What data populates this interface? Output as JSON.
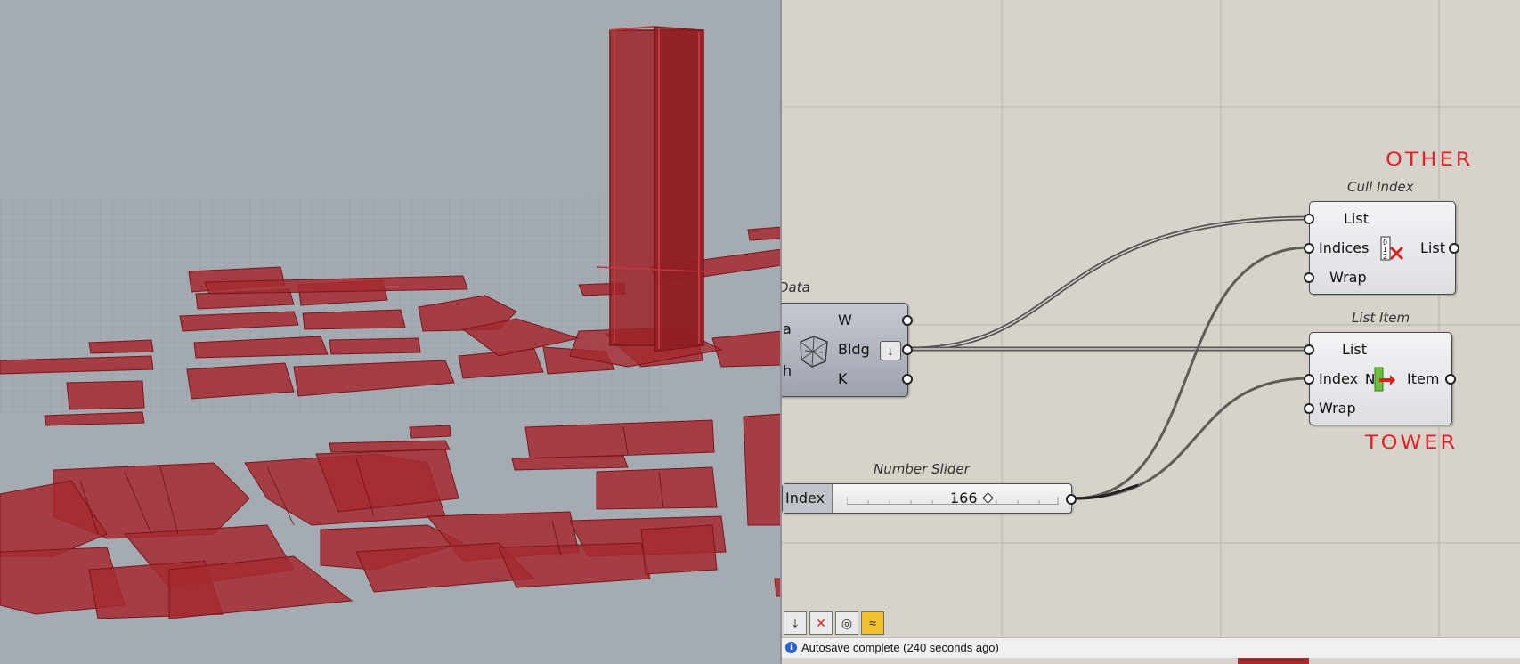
{
  "gh_canvas": {
    "data_component": {
      "title_partial": "Data",
      "inputs": [
        "a",
        "h"
      ],
      "outputs": [
        "W",
        "Bldg",
        "K"
      ]
    },
    "cull_index": {
      "title": "Cull Index",
      "inputs": [
        "List",
        "Indices",
        "Wrap"
      ],
      "output": "List"
    },
    "list_item": {
      "title": "List Item",
      "inputs": [
        "List",
        "Index",
        "Wrap"
      ],
      "output": "Item"
    },
    "number_slider": {
      "title": "Number Slider",
      "label": "Index",
      "value": "166"
    },
    "annotations": {
      "other": "OTHER",
      "tower": "TOWER"
    }
  },
  "toolbar": {
    "buttons": [
      "bake-icon",
      "cull-icon",
      "preview-icon",
      "rhino-icon"
    ]
  },
  "statusbar": {
    "text": "Autosave complete (240 seconds ago)"
  },
  "colors": {
    "building_red": "#b5262c",
    "annotation_red": "#e41f2a",
    "canvas_bg": "#d7d3cb",
    "viewport_bg": "#a5abb2"
  }
}
